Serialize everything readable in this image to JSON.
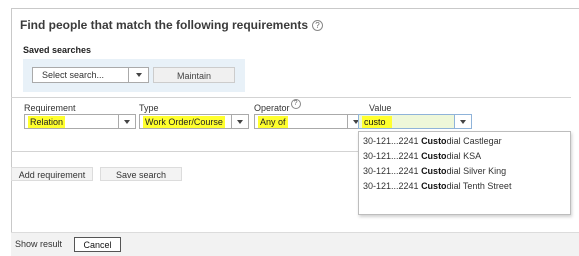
{
  "header": {
    "title": "Find people that match the following requirements",
    "help_icon": "?"
  },
  "saved_searches": {
    "label": "Saved searches",
    "select_placeholder": "Select search...",
    "maintain_label": "Maintain"
  },
  "criteria": {
    "columns": {
      "requirement": "Requirement",
      "type": "Type",
      "operator": "Operator",
      "value": "Value"
    },
    "operator_help_icon": "?",
    "requirement_value": "Relation",
    "type_value": "Work Order/Course",
    "operator_value": "Any of",
    "value_input": "custo",
    "suggestions": [
      {
        "prefix": "30-121...2241 ",
        "match": "Custo",
        "suffix": "dial Castlegar"
      },
      {
        "prefix": "30-121...2241 ",
        "match": "Custo",
        "suffix": "dial KSA"
      },
      {
        "prefix": "30-121...2241 ",
        "match": "Custo",
        "suffix": "dial Silver King"
      },
      {
        "prefix": "30-121...2241 ",
        "match": "Custo",
        "suffix": "dial Tenth Street"
      }
    ]
  },
  "actions": {
    "add_requirement": "Add requirement",
    "save_search": "Save search"
  },
  "footer": {
    "show_result": "Show result",
    "cancel": "Cancel"
  },
  "colors": {
    "highlight": "#ffff2d",
    "saved_box_bg": "#e8f1f8",
    "value_field_bg": "#eef7d9",
    "focus_border": "#8fb3d9"
  },
  "icons": {
    "help": "help-icon",
    "dropdown": "chevron-down-icon"
  }
}
